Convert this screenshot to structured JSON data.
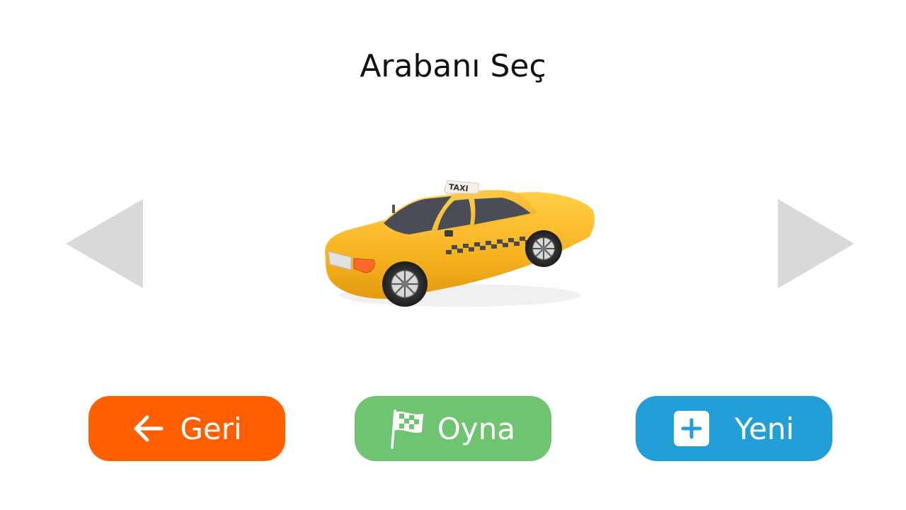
{
  "title": "Arabanı Seç",
  "car": {
    "roof_sign_text": "TAXI"
  },
  "navigation": {
    "prev_icon": "triangle-left-icon",
    "next_icon": "triangle-right-icon",
    "arrow_color": "#d9d9d9"
  },
  "buttons": {
    "back": {
      "label": "Geri",
      "icon": "arrow-left-icon",
      "color": "#ff5f00"
    },
    "play": {
      "label": "Oyna",
      "icon": "checkered-flag-icon",
      "color": "#6fc472"
    },
    "new": {
      "label": "Yeni",
      "icon": "plus-square-icon",
      "color": "#239fd8"
    }
  }
}
